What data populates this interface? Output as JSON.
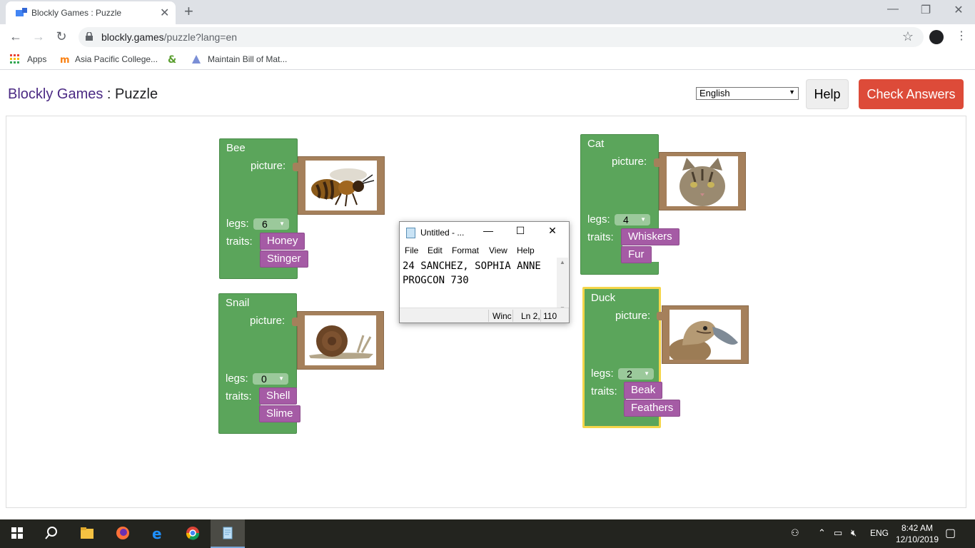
{
  "browser": {
    "tab_title": "Blockly Games : Puzzle",
    "url_host": "blockly.games",
    "url_path": "/puzzle?lang=en",
    "bookmarks": [
      "Apps",
      "Asia Pacific College...",
      "Maintain Bill of Mat..."
    ]
  },
  "page": {
    "brand_link": "Blockly Games",
    "brand_sep": " : ",
    "brand_title": "Puzzle",
    "language": "English",
    "help_label": "Help",
    "check_label": "Check Answers"
  },
  "animals": [
    {
      "name": "Bee",
      "picture_label": "picture:",
      "legs_label": "legs:",
      "legs": "6",
      "traits_label": "traits:",
      "traits": [
        "Honey",
        "Stinger"
      ],
      "image": "bee"
    },
    {
      "name": "Snail",
      "picture_label": "picture:",
      "legs_label": "legs:",
      "legs": "0",
      "traits_label": "traits:",
      "traits": [
        "Shell",
        "Slime"
      ],
      "image": "snail"
    },
    {
      "name": "Cat",
      "picture_label": "picture:",
      "legs_label": "legs:",
      "legs": "4",
      "traits_label": "traits:",
      "traits": [
        "Whiskers",
        "Fur"
      ],
      "image": "cat"
    },
    {
      "name": "Duck",
      "picture_label": "picture:",
      "legs_label": "legs:",
      "legs": "2",
      "traits_label": "traits:",
      "traits": [
        "Beak",
        "Feathers"
      ],
      "image": "duck",
      "selected": true
    }
  ],
  "notepad": {
    "title": "Untitled - ...",
    "menu": [
      "File",
      "Edit",
      "Format",
      "View",
      "Help"
    ],
    "content": "24 SANCHEZ, SOPHIA ANNE\nPROGCON 730",
    "status_eol": "Winc",
    "status_pos": "Ln 2,",
    "status_zoom": "110"
  },
  "taskbar": {
    "language": "ENG",
    "time": "8:42 AM",
    "date": "12/10/2019"
  },
  "colors": {
    "animal_block": "#5ba55b",
    "trait_block": "#a55ba5",
    "picture_block": "#a5805b",
    "check_button": "#dd4b39",
    "brand_link": "#4b2a84"
  }
}
